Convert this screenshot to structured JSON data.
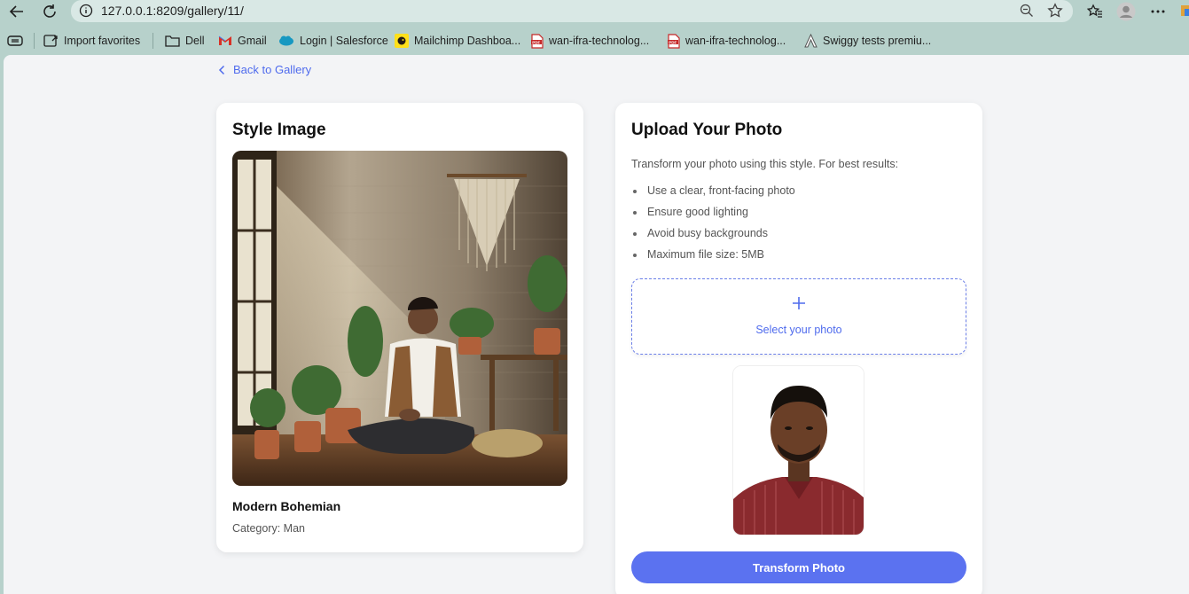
{
  "browser": {
    "url": "127.0.0.1:8209/gallery/11/",
    "bookmarks": [
      {
        "label": "Import favorites",
        "icon": "import-icon"
      },
      {
        "label": "Dell",
        "icon": "folder-icon"
      },
      {
        "label": "Gmail",
        "icon": "gmail-icon"
      },
      {
        "label": "Login | Salesforce",
        "icon": "salesforce-icon"
      },
      {
        "label": "Mailchimp Dashboa...",
        "icon": "mailchimp-icon"
      },
      {
        "label": "wan-ifra-technolog...",
        "icon": "pdf-icon"
      },
      {
        "label": "wan-ifra-technolog...",
        "icon": "pdf-icon"
      },
      {
        "label": "Swiggy tests premiu...",
        "icon": "swiggy-icon"
      }
    ]
  },
  "page": {
    "back_label": "Back to Gallery",
    "style_card": {
      "title": "Style Image",
      "name": "Modern Bohemian",
      "category": "Category: Man"
    },
    "upload_card": {
      "title": "Upload Your Photo",
      "intro": "Transform your photo using this style. For best results:",
      "tips": [
        "Use a clear, front-facing photo",
        "Ensure good lighting",
        "Avoid busy backgrounds",
        "Maximum file size: 5MB"
      ],
      "select_label": "Select your photo",
      "button_label": "Transform Photo"
    }
  },
  "colors": {
    "accent": "#5b72f0",
    "link": "#4f6bed",
    "chrome": "#b7d1cb",
    "page_bg": "#f3f4f6"
  }
}
